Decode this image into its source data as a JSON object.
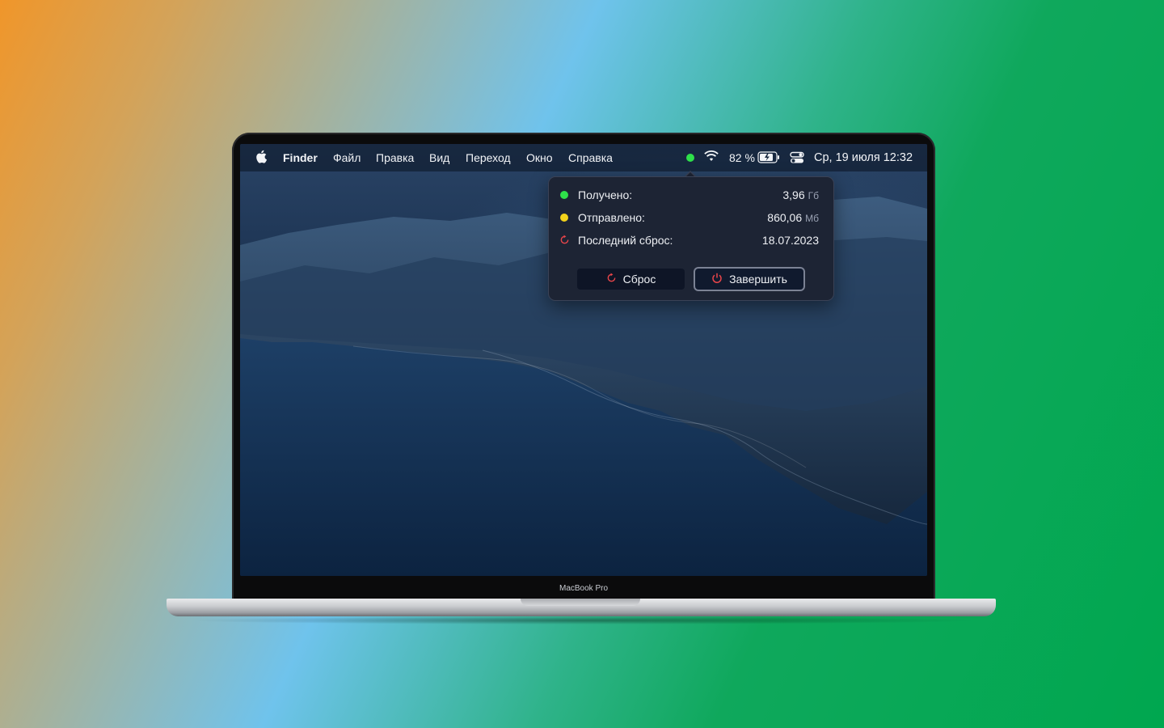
{
  "menubar": {
    "app_name": "Finder",
    "menus": [
      "Файл",
      "Правка",
      "Вид",
      "Переход",
      "Окно",
      "Справка"
    ],
    "battery_percent": "82 %",
    "datetime": "Ср, 19 июля  12:32",
    "status_dot_color": "#2ee04a",
    "icons": [
      "apple-icon",
      "wifi-icon",
      "battery-icon",
      "control-center-icon"
    ]
  },
  "popover": {
    "rows": [
      {
        "label": "Получено:",
        "value": "3,96",
        "unit": "Гб",
        "indicator_color": "#2ee04a"
      },
      {
        "label": "Отправлено:",
        "value": "860,06",
        "unit": "Мб",
        "indicator_color": "#f2d21b"
      },
      {
        "label": "Последний сброс:",
        "value": "18.07.2023",
        "unit": "",
        "indicator": "reset-icon"
      }
    ],
    "buttons": {
      "reset": {
        "label": "Сброс",
        "icon": "reset-icon"
      },
      "quit": {
        "label": "Завершить",
        "icon": "power-icon"
      }
    }
  },
  "device": {
    "model_label": "MacBook Pro"
  }
}
